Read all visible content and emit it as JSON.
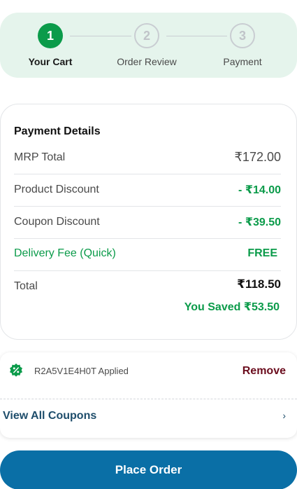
{
  "stepper": {
    "steps": [
      {
        "number": "1",
        "label": "Your Cart"
      },
      {
        "number": "2",
        "label": "Order Review"
      },
      {
        "number": "3",
        "label": "Payment"
      }
    ]
  },
  "payment": {
    "title": "Payment Details",
    "rows": [
      {
        "label": "MRP Total",
        "value": "₹172.00"
      },
      {
        "label": "Product Discount",
        "value": "- ₹14.00"
      },
      {
        "label": "Coupon Discount",
        "value": "- ₹39.50"
      },
      {
        "label": "Delivery Fee (Quick)",
        "value": "FREE"
      }
    ],
    "total_label": "Total",
    "total_value": "₹118.50",
    "saved_text": "You Saved ₹53.50"
  },
  "coupon": {
    "applied_text": "R2A5V1E4H0T Applied",
    "remove_label": "Remove",
    "view_all_label": "View All Coupons",
    "chevron": "›"
  },
  "action": {
    "place_order_label": "Place Order"
  },
  "colors": {
    "accent_green": "#0b9b4a",
    "button_blue": "#0a6fa6",
    "remove_maroon": "#6b0d1e",
    "stepper_bg": "#e5f4ec"
  }
}
